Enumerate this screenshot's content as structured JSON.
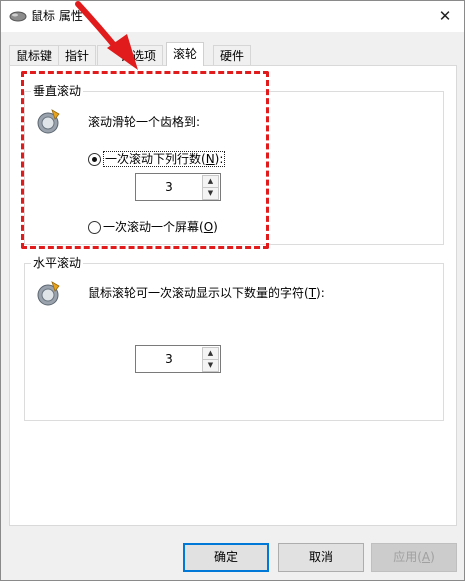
{
  "window": {
    "title": "鼠标 属性",
    "icons": {
      "app": "mouse-icon",
      "close": "close-icon"
    }
  },
  "tabs": [
    {
      "label": "鼠标键",
      "mnemonic": ""
    },
    {
      "label": "指针",
      "mnemonic": ""
    },
    {
      "label": "针选项",
      "mnemonic": ""
    },
    {
      "label": "滚轮",
      "mnemonic": ""
    },
    {
      "label": "硬件",
      "mnemonic": ""
    }
  ],
  "vertical": {
    "group_title": "垂直滚动",
    "prompt": "滚动滑轮一个齿格到:",
    "option_lines_pre": "一次滚动下列行数(",
    "option_lines_mn": "N",
    "option_lines_post": "):",
    "lines_value": "3",
    "option_screen_pre": "一次滚动一个屏幕(",
    "option_screen_mn": "O",
    "option_screen_post": ")",
    "selected": "lines"
  },
  "horizontal": {
    "group_title": "水平滚动",
    "prompt_pre": "鼠标滚轮可一次滚动显示以下数量的字符(",
    "prompt_mn": "T",
    "prompt_post": "):",
    "chars_value": "3"
  },
  "buttons": {
    "ok": "确定",
    "cancel": "取消",
    "apply_pre": "应用(",
    "apply_mn": "A",
    "apply_post": ")"
  },
  "colors": {
    "annotation": "#e11b1b",
    "accent": "#0078d7"
  }
}
